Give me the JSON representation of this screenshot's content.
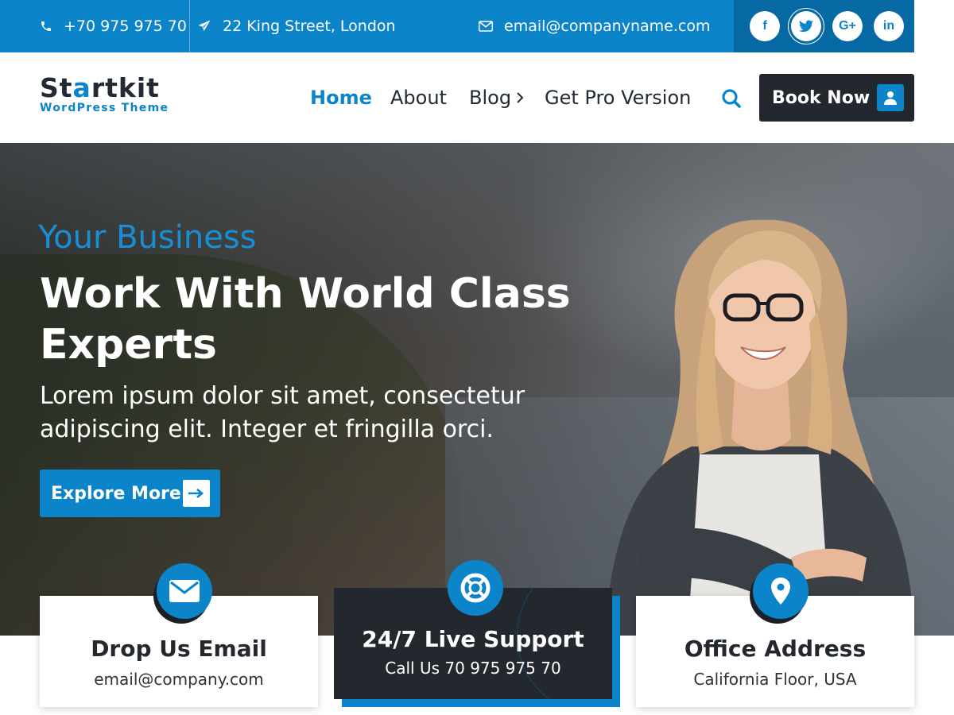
{
  "topbar": {
    "phone": "+70 975 975 70",
    "address": "22 King Street, London",
    "email": "email@companyname.com",
    "social": [
      "facebook-icon",
      "twitter-icon",
      "google-plus-icon",
      "linkedin-icon"
    ],
    "social_labels": {
      "facebook": "f",
      "google": "G+",
      "linkedin": "in"
    }
  },
  "logo": {
    "main_start": "St",
    "main_accent": "a",
    "main_end": "rtkit",
    "sub": "WordPress Theme"
  },
  "nav": {
    "items": [
      {
        "label": "Home",
        "active": true
      },
      {
        "label": "About"
      },
      {
        "label": "Blog",
        "has_submenu": true
      },
      {
        "label": "Get Pro Version"
      }
    ],
    "cta_label": "Book Now"
  },
  "hero": {
    "kicker": "Your Business",
    "title_line1": "Work With World Class",
    "title_line2": "Experts",
    "text_line1": "Lorem ipsum dolor sit amet, consectetur",
    "text_line2": "adipiscing elit. Integer et fringilla orci.",
    "button_label": "Explore More"
  },
  "features": [
    {
      "title": "Drop Us Email",
      "subtitle": "email@company.com",
      "icon": "envelope-icon"
    },
    {
      "title": "24/7 Live Support",
      "subtitle": "Call Us 70 975 975 70",
      "icon": "lifebuoy-icon"
    },
    {
      "title": "Office Address",
      "subtitle": "California Floor, USA",
      "icon": "map-pin-icon"
    }
  ],
  "colors": {
    "accent": "#0b84c9",
    "dark": "#23272e",
    "topbar_dark": "#0769a3"
  }
}
